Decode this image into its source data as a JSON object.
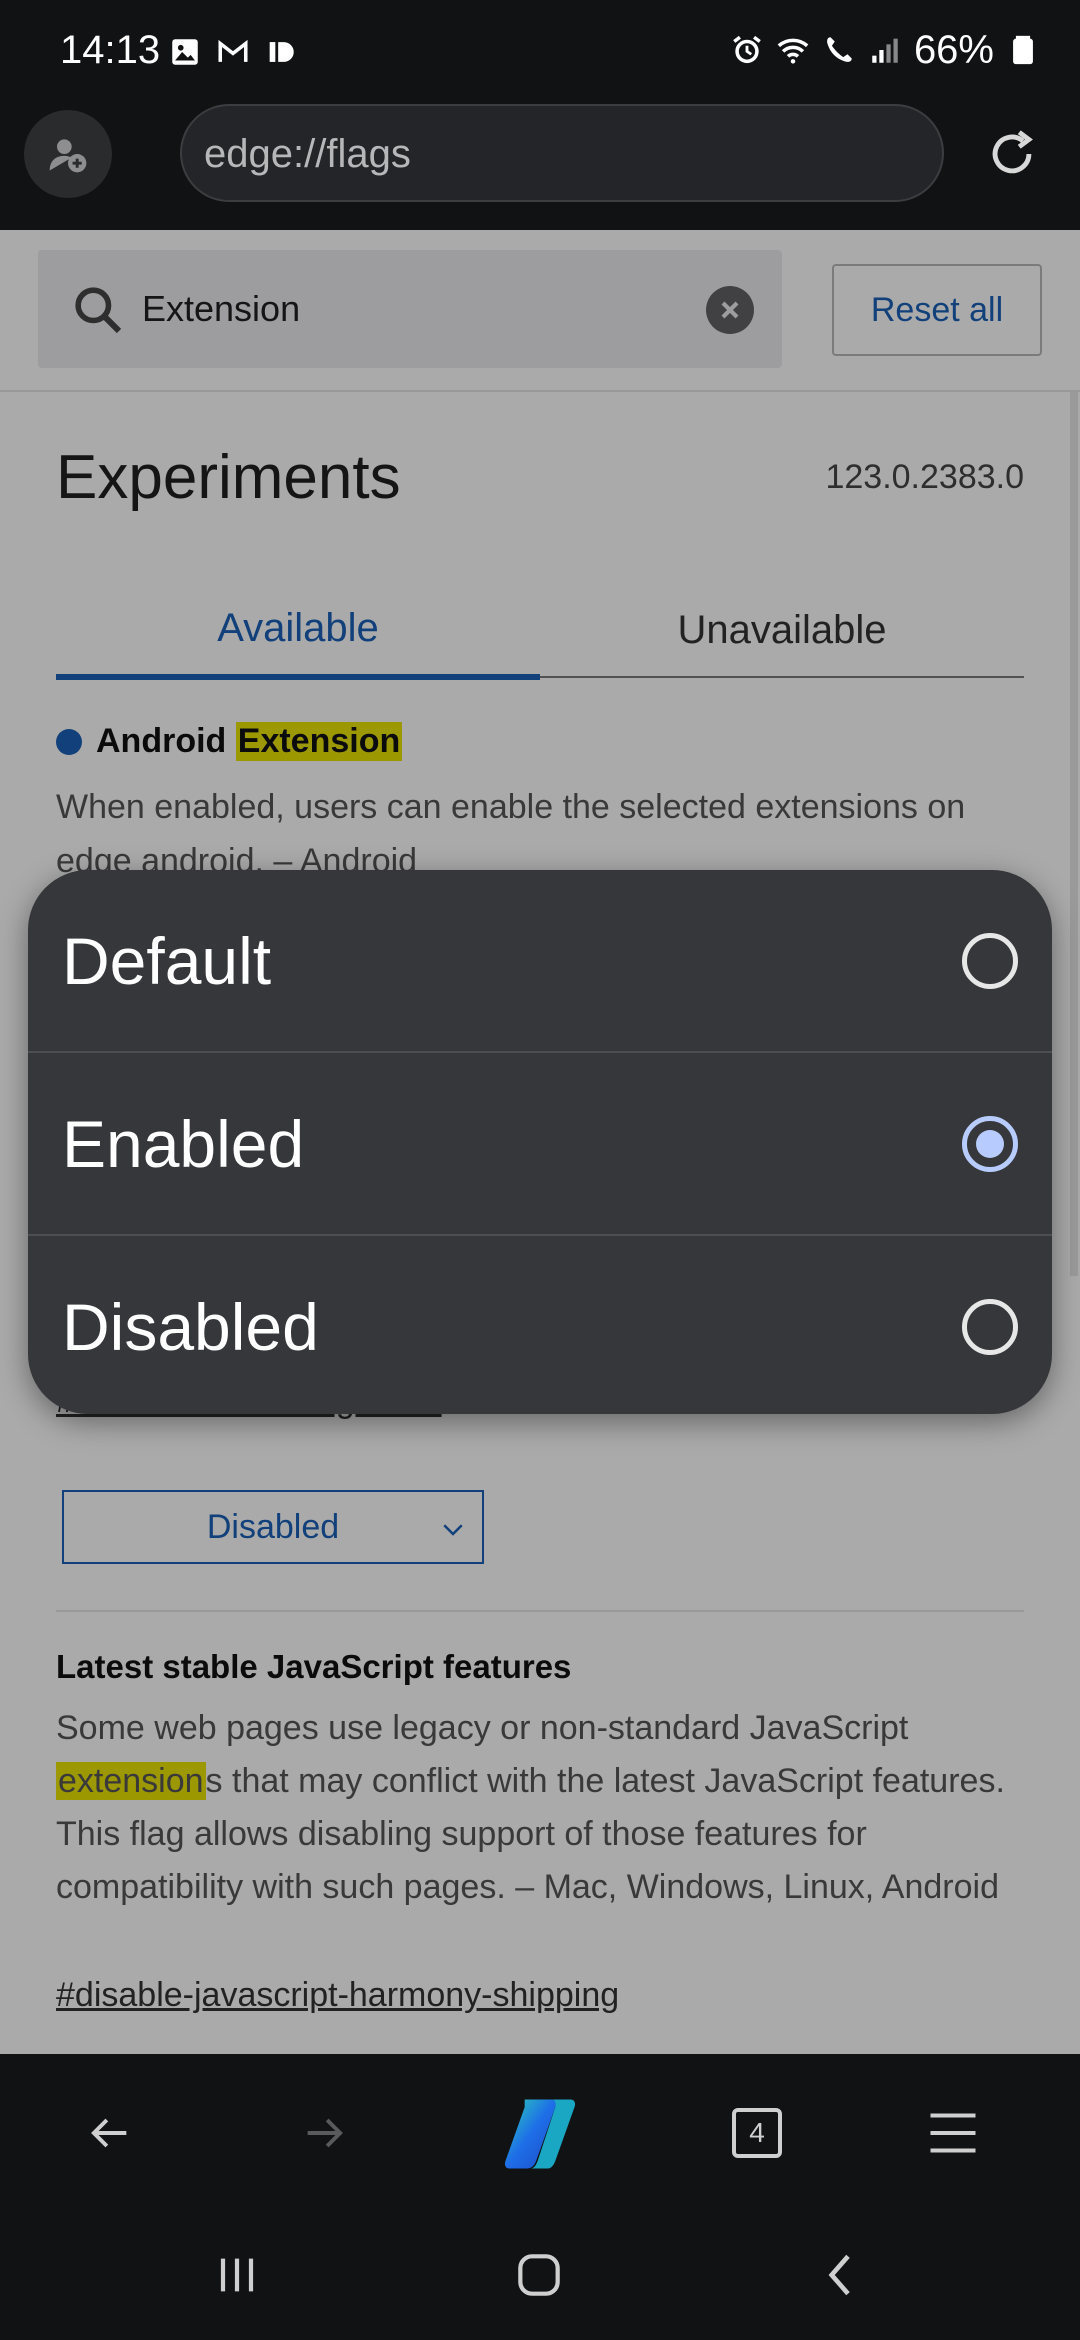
{
  "status_bar": {
    "time": "14:13",
    "battery": "66%",
    "left_icons": [
      "gallery-icon",
      "gmail-icon",
      "id-icon"
    ],
    "right_icons": [
      "alarm-icon",
      "wifi-icon",
      "wifi-call-icon",
      "signal-icon",
      "battery-icon"
    ]
  },
  "browser": {
    "url": "edge://flags"
  },
  "search": {
    "value": "Extension",
    "reset_label": "Reset all"
  },
  "page": {
    "title": "Experiments",
    "version": "123.0.2383.0",
    "tabs": [
      {
        "label": "Available",
        "active": true
      },
      {
        "label": "Unavailable",
        "active": false
      }
    ]
  },
  "flags": [
    {
      "title_prefix": "Android ",
      "title_highlight": "Extension",
      "description": "When enabled, users can enable the selected extensions on edge android. – Android",
      "link": "#extensions-on-edge-android",
      "link_visible": "#extensions-on-edge-and",
      "state": "Disabled"
    },
    {
      "title": "Latest stable JavaScript features",
      "description_highlight": "extension",
      "description_before": "Some web pages use legacy or non-standard JavaScript ",
      "description_after": "s that may conflict with the latest JavaScript features. This flag allows disabling support of those features for compatibility with such pages. – Mac, Windows, Linux, Android",
      "link": "#disable-javascript-harmony-shipping"
    }
  ],
  "dialog": {
    "options": [
      {
        "label": "Default",
        "selected": false
      },
      {
        "label": "Enabled",
        "selected": true
      },
      {
        "label": "Disabled",
        "selected": false
      }
    ]
  },
  "toolbar": {
    "tab_count": "4"
  },
  "colors": {
    "accent": "#1a5fb4",
    "highlight": "#e6e000",
    "dialog_bg": "#36373b",
    "radio_selected": "#b7cbff"
  }
}
